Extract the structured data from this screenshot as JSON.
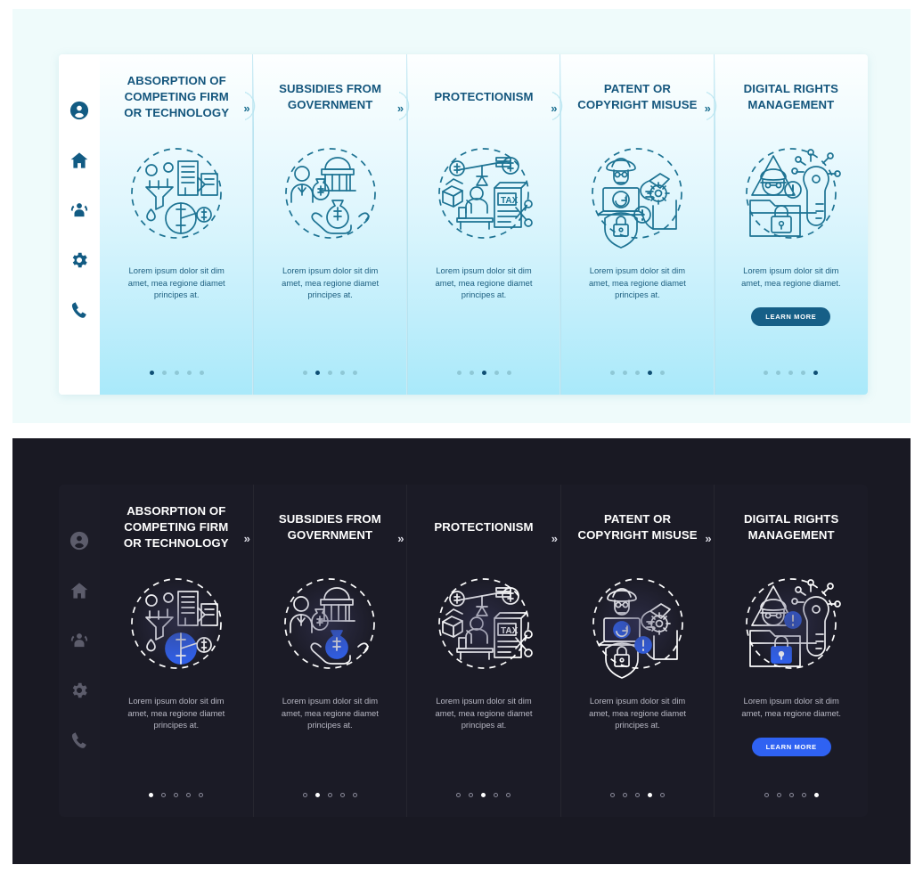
{
  "theme_colors": {
    "light_page_bg": "#effbfb",
    "light_panel_top": "#fdffff",
    "light_panel_bottom": "#a9e9fa",
    "light_accent": "#14567d",
    "light_button": "#165f87",
    "dark_page_bg": "#191923",
    "dark_panel_bg": "#1b1b26",
    "dark_sidebar_bg": "#1c1c27",
    "dark_accent": "#ffffff",
    "dark_button": "#2f62f2",
    "icon_blue": "#2f62f2"
  },
  "sidebar": {
    "items": [
      {
        "icon": "user-circle-icon",
        "label": "Profile"
      },
      {
        "icon": "home-icon",
        "label": "Home"
      },
      {
        "icon": "group-icon",
        "label": "Team"
      },
      {
        "icon": "gear-icon",
        "label": "Settings"
      },
      {
        "icon": "phone-icon",
        "label": "Contact"
      }
    ]
  },
  "separator": {
    "chevron": "»"
  },
  "body_text": {
    "long": "Lorem ipsum dolor sit dim amet, mea regione diamet principes at.",
    "short": "Lorem ipsum dolor sit dim amet, mea regione diamet."
  },
  "learn_more_label": "LEARN MORE",
  "panels": [
    {
      "title": "ABSORPTION OF COMPETING FIRM OR TECHNOLOGY",
      "illustration": "absorption-merger-icon",
      "body": "Lorem ipsum dolor sit dim amet, mea regione diamet principes at.",
      "has_button": false,
      "dots_total": 5,
      "dots_active": 1
    },
    {
      "title": "SUBSIDIES FROM GOVERNMENT",
      "illustration": "government-subsidy-icon",
      "body": "Lorem ipsum dolor sit dim amet, mea regione diamet principes at.",
      "has_button": false,
      "dots_total": 5,
      "dots_active": 2
    },
    {
      "title": "PROTECTIONISM",
      "illustration": "tax-protectionism-icon",
      "body": "Lorem ipsum dolor sit dim amet, mea regione diamet principes at.",
      "has_button": false,
      "dots_total": 5,
      "dots_active": 3
    },
    {
      "title": "PATENT OR COPYRIGHT MISUSE",
      "illustration": "piracy-patent-icon",
      "body": "Lorem ipsum dolor sit dim amet, mea regione diamet principes at.",
      "has_button": false,
      "dots_total": 5,
      "dots_active": 4
    },
    {
      "title": "DIGITAL RIGHTS MANAGEMENT",
      "illustration": "digital-rights-lock-icon",
      "body": "Lorem ipsum dolor sit dim amet, mea regione diamet.",
      "has_button": true,
      "dots_total": 5,
      "dots_active": 5
    }
  ]
}
